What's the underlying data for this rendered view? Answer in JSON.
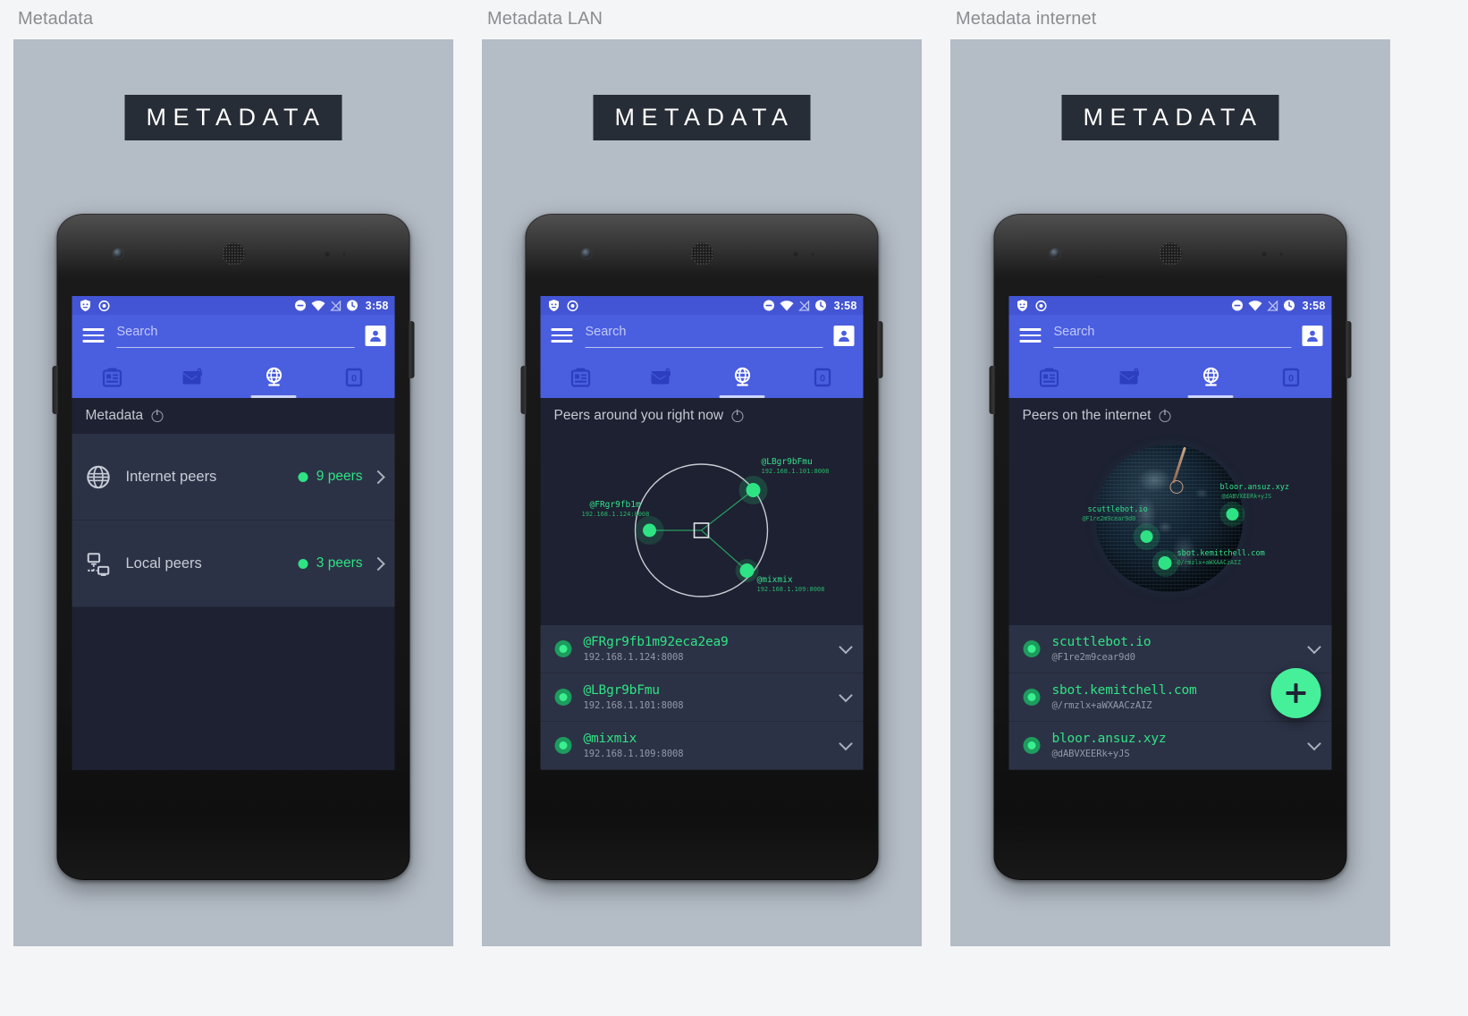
{
  "panels": [
    {
      "caption": "Metadata",
      "logo": "METADATA"
    },
    {
      "caption": "Metadata LAN",
      "logo": "METADATA"
    },
    {
      "caption": "Metadata internet",
      "logo": "METADATA"
    }
  ],
  "statusbar": {
    "time": "3:58",
    "left_icons": [
      "shield-icon",
      "target-icon"
    ],
    "right_icons": [
      "do-not-disturb-icon",
      "wifi-icon",
      "no-signal-icon",
      "alarm-icon"
    ]
  },
  "appbar": {
    "menu_icon": "hamburger-icon",
    "search_placeholder": "Search",
    "search_value": "",
    "avatar_icon": "account-icon",
    "tabs": [
      {
        "name": "public-feed",
        "icon": "board-icon",
        "active": false
      },
      {
        "name": "private-messages",
        "icon": "envelope-lock-icon",
        "active": false
      },
      {
        "name": "network",
        "icon": "globe-icon",
        "active": true
      },
      {
        "name": "notifications",
        "icon": "counter-icon",
        "badge": "0",
        "active": false
      }
    ]
  },
  "screen1": {
    "section_title": "Metadata",
    "rows": [
      {
        "icon": "globe-icon",
        "label": "Internet peers",
        "count": "9 peers",
        "chevron": "chevron-right-icon"
      },
      {
        "icon": "network-icon",
        "label": "Local peers",
        "count": "3 peers",
        "chevron": "chevron-right-icon"
      }
    ]
  },
  "screen2": {
    "section_title": "Peers around you right now",
    "map_nodes": [
      {
        "name": "@LBgr9bFmu",
        "addr": "192.168.1.101:8008"
      },
      {
        "name": "@FRgr9fb1m",
        "addr": "192.168.1.124:8008"
      },
      {
        "name": "@mixmix",
        "addr": "192.168.1.109:8008"
      }
    ],
    "peers": [
      {
        "title": "@FRgr9fb1m92eca2ea9",
        "sub": "192.168.1.124:8008"
      },
      {
        "title": "@LBgr9bFmu",
        "sub": "192.168.1.101:8008"
      },
      {
        "title": "@mixmix",
        "sub": "192.168.1.109:8008"
      }
    ]
  },
  "screen3": {
    "section_title": "Peers on the internet",
    "map_nodes": [
      {
        "name": "bloor.ansuz.xyz",
        "id": "@dABVXEERk+yJS"
      },
      {
        "name": "scuttlebot.io",
        "id": "@F1re2m9cear9d0"
      },
      {
        "name": "sbot.kemitchell.com",
        "id": "@/rmzlx+aWXAACzAIZ"
      }
    ],
    "peers": [
      {
        "title": "scuttlebot.io",
        "sub": "@F1re2m9cear9d0"
      },
      {
        "title": "sbot.kemitchell.com",
        "sub": "@/rmzlx+aWXAACzAIZ"
      },
      {
        "title": "bloor.ansuz.xyz",
        "sub": "@dABVXEERk+yJS"
      }
    ],
    "fab": {
      "icon": "plus-icon",
      "label": "Add peer"
    }
  },
  "colors": {
    "accent_green": "#2ee383",
    "appbar_blue": "#4a5ee0",
    "statusbar_blue": "#4355d4",
    "screen_bg": "#1d2131",
    "row_bg": "#2c3246",
    "panel_bg": "#b4bcc6",
    "logo_bg": "#272d36"
  }
}
